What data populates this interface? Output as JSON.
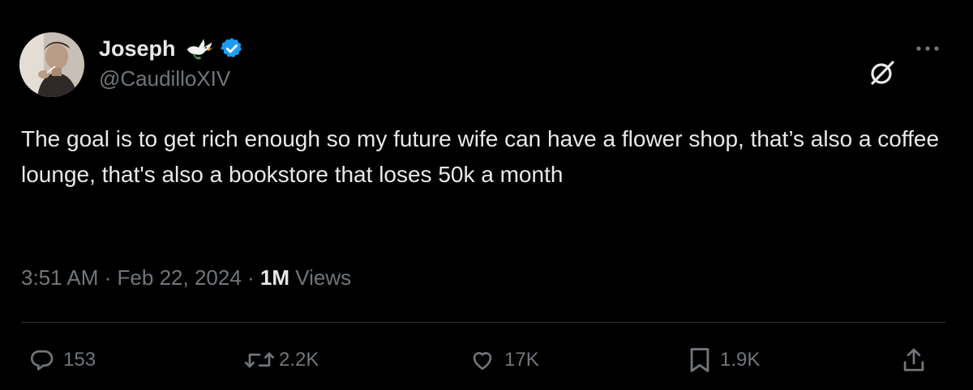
{
  "author": {
    "display_name": "Joseph",
    "handle": "@CaudilloXIV",
    "emoji_icon": "dove-icon",
    "verified_icon": "verified-badge-icon"
  },
  "header_icons": {
    "grok": "grok-icon",
    "more": "more-options-icon"
  },
  "tweet": {
    "text": "The goal is to get rich enough so my future wife can have a flower shop, that’s also a coffee lounge, that's also a bookstore that loses 50k a month",
    "time": "3:51 AM",
    "separator": "·",
    "date": "Feb 22, 2024",
    "views_count": "1M",
    "views_label": "Views"
  },
  "actions": {
    "replies": "153",
    "reposts": "2.2K",
    "likes": "17K",
    "bookmarks": "1.9K"
  },
  "colors": {
    "background": "#000000",
    "primary_text": "#e7e9ea",
    "secondary_text": "#71767b",
    "verified_blue": "#1d9bf0",
    "divider": "#2f3336"
  }
}
